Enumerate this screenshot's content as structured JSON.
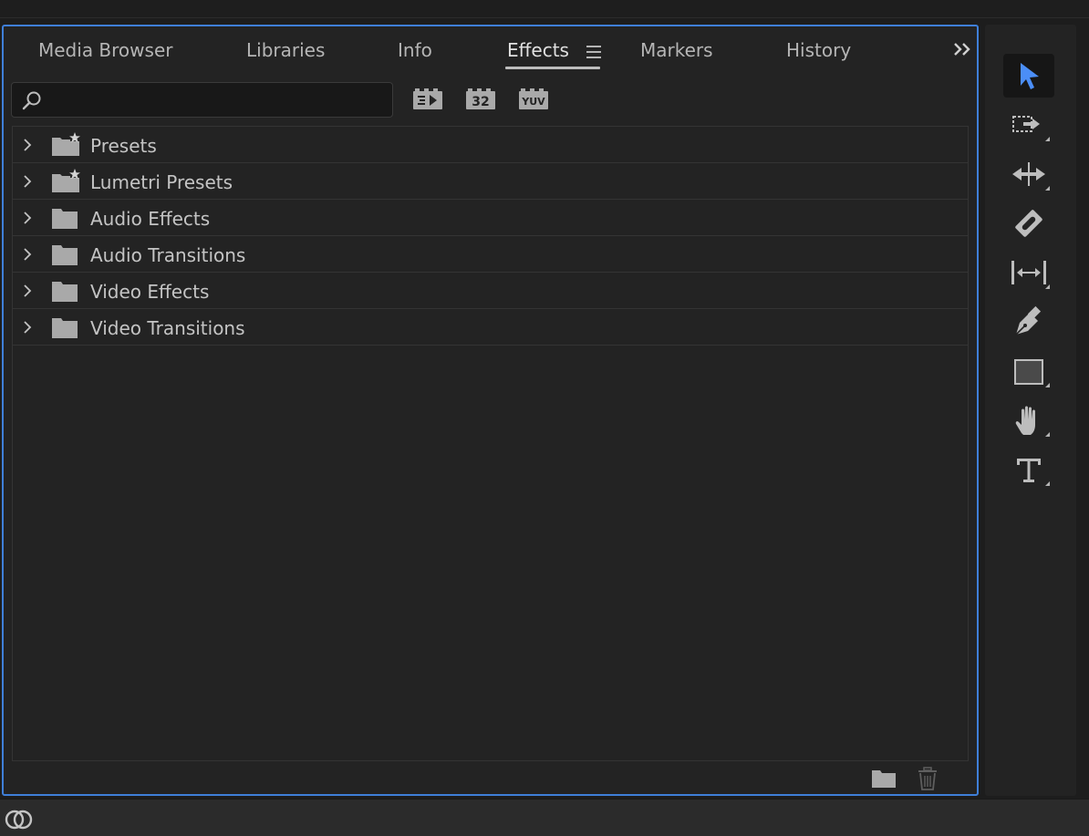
{
  "tabs": [
    {
      "label": "Media Browser",
      "active": false
    },
    {
      "label": "Libraries",
      "active": false
    },
    {
      "label": "Info",
      "active": false
    },
    {
      "label": "Effects",
      "active": true
    },
    {
      "label": "Markers",
      "active": false
    },
    {
      "label": "History",
      "active": false
    }
  ],
  "search": {
    "value": "",
    "placeholder": ""
  },
  "filters": [
    {
      "icon": "accelerated-effects-icon",
      "text": ""
    },
    {
      "icon": "32-bit-color-icon",
      "text": "32"
    },
    {
      "icon": "yuv-effects-icon",
      "text": "YUV"
    }
  ],
  "tree": [
    {
      "label": "Presets",
      "icon": "folder-star-icon"
    },
    {
      "label": "Lumetri Presets",
      "icon": "folder-star-icon"
    },
    {
      "label": "Audio Effects",
      "icon": "folder-icon"
    },
    {
      "label": "Audio Transitions",
      "icon": "folder-icon"
    },
    {
      "label": "Video Effects",
      "icon": "folder-icon"
    },
    {
      "label": "Video Transitions",
      "icon": "folder-icon"
    }
  ],
  "tools": [
    {
      "name": "selection-tool",
      "icon": "arrow-icon",
      "active": true
    },
    {
      "name": "track-select-tool",
      "icon": "track-select-icon",
      "active": false
    },
    {
      "name": "ripple-edit-tool",
      "icon": "ripple-edit-icon",
      "active": false
    },
    {
      "name": "razor-tool",
      "icon": "razor-icon",
      "active": false
    },
    {
      "name": "slip-tool",
      "icon": "slip-icon",
      "active": false
    },
    {
      "name": "pen-tool",
      "icon": "pen-icon",
      "active": false
    },
    {
      "name": "rectangle-tool",
      "icon": "rectangle-icon",
      "active": false
    },
    {
      "name": "hand-tool",
      "icon": "hand-icon",
      "active": false
    },
    {
      "name": "type-tool",
      "icon": "type-icon",
      "active": false
    }
  ],
  "colors": {
    "accent": "#3f7fd8",
    "panel": "#232323",
    "background": "#1d1d1d",
    "text": "#c4c4c4",
    "active_tool": "#4b8ef7"
  }
}
